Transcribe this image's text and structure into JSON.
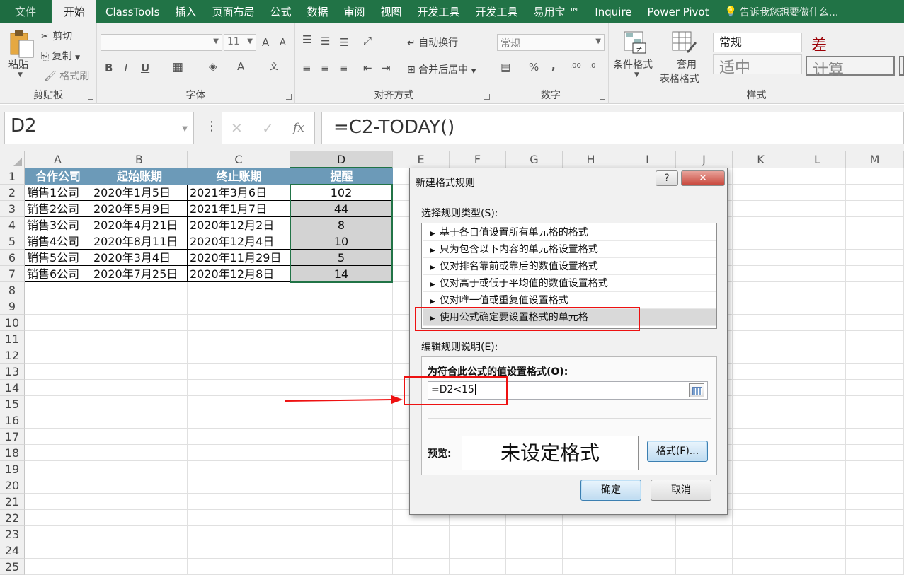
{
  "menubar": {
    "tabs": [
      "文件",
      "开始",
      "ClassTools",
      "插入",
      "页面布局",
      "公式",
      "数据",
      "审阅",
      "视图",
      "开发工具",
      "开发工具",
      "易用宝 ™",
      "Inquire",
      "Power Pivot"
    ],
    "tell_me": "告诉我您想要做什么..."
  },
  "ribbon": {
    "clipboard": {
      "paste": "粘贴",
      "cut": "剪切",
      "copy": "复制",
      "format_painter": "格式刷",
      "label": "剪贴板"
    },
    "font": {
      "font_size": "11",
      "bold": "B",
      "italic": "I",
      "underline": "U",
      "grow": "A",
      "shrink": "A",
      "font_color": "A",
      "label": "字体"
    },
    "alignment": {
      "wrap_text": "自动换行",
      "merge_center": "合并后居中",
      "label": "对齐方式"
    },
    "number": {
      "format": "常规",
      "percent": "%",
      "comma": ",",
      "label": "数字"
    },
    "styles": {
      "conditional": "条件格式",
      "table_1": "套用",
      "table_2": "表格格式",
      "normal": "常规",
      "bad": "差",
      "neutral": "适中",
      "calculation": "计算",
      "label": "样式"
    }
  },
  "formula_bar": {
    "name_box": "D2",
    "more": "⋮",
    "cancel": "✕",
    "enter": "✓",
    "fx": "fx",
    "formula": "=C2-TODAY()"
  },
  "sheet": {
    "columns": [
      "A",
      "B",
      "C",
      "D",
      "E",
      "F",
      "G",
      "H",
      "I",
      "J",
      "K",
      "L",
      "M"
    ],
    "rows": [
      "1",
      "2",
      "3",
      "4",
      "5",
      "6",
      "7",
      "8",
      "9",
      "10",
      "11",
      "12",
      "13",
      "14",
      "15",
      "16",
      "17",
      "18",
      "19",
      "20",
      "21",
      "22",
      "23",
      "24",
      "25"
    ],
    "headers": [
      "合作公司",
      "起始账期",
      "终止账期",
      "提醒"
    ],
    "data": [
      [
        "销售1公司",
        "2020年1月5日",
        "2021年3月6日",
        "102"
      ],
      [
        "销售2公司",
        "2020年5月9日",
        "2021年1月7日",
        "44"
      ],
      [
        "销售3公司",
        "2020年4月21日",
        "2020年12月2日",
        "8"
      ],
      [
        "销售4公司",
        "2020年8月11日",
        "2020年12月4日",
        "10"
      ],
      [
        "销售5公司",
        "2020年3月4日",
        "2020年11月29日",
        "5"
      ],
      [
        "销售6公司",
        "2020年7月25日",
        "2020年12月8日",
        "14"
      ]
    ]
  },
  "dialog": {
    "title": "新建格式规则",
    "help": "?",
    "close": "✕",
    "select_type_label": "选择规则类型(S):",
    "rule_types": [
      "基于各自值设置所有单元格的格式",
      "只为包含以下内容的单元格设置格式",
      "仅对排名靠前或靠后的数值设置格式",
      "仅对高于或低于平均值的数值设置格式",
      "仅对唯一值或重复值设置格式",
      "使用公式确定要设置格式的单元格"
    ],
    "edit_desc_label": "编辑规则说明(E):",
    "formula_label": "为符合此公式的值设置格式(O):",
    "formula_value": "=D2<15",
    "preview_label": "预览:",
    "preview_text": "未设定格式",
    "format_button": "格式(F)...",
    "ok": "确定",
    "cancel": "取消"
  },
  "colors": {
    "excel_green": "#217346",
    "header_fill": "#6c9ab8",
    "highlight_red": "#e11111"
  }
}
